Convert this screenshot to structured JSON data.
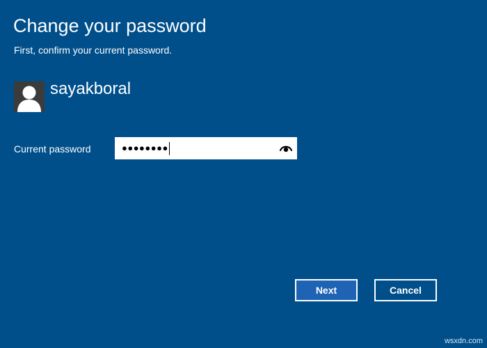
{
  "dialog": {
    "title": "Change your password",
    "subtitle": "First, confirm your current password.",
    "username": "sayakboral",
    "avatar_icon": "user-silhouette-icon"
  },
  "form": {
    "current_password_label": "Current password",
    "current_password_value": "●●●●●●●●",
    "reveal_icon": "eye-icon"
  },
  "buttons": {
    "next_label": "Next",
    "cancel_label": "Cancel"
  },
  "watermark": "wsxdn.com",
  "colors": {
    "background": "#004f8b",
    "primary_button": "#1e63b4",
    "text": "#ffffff"
  }
}
